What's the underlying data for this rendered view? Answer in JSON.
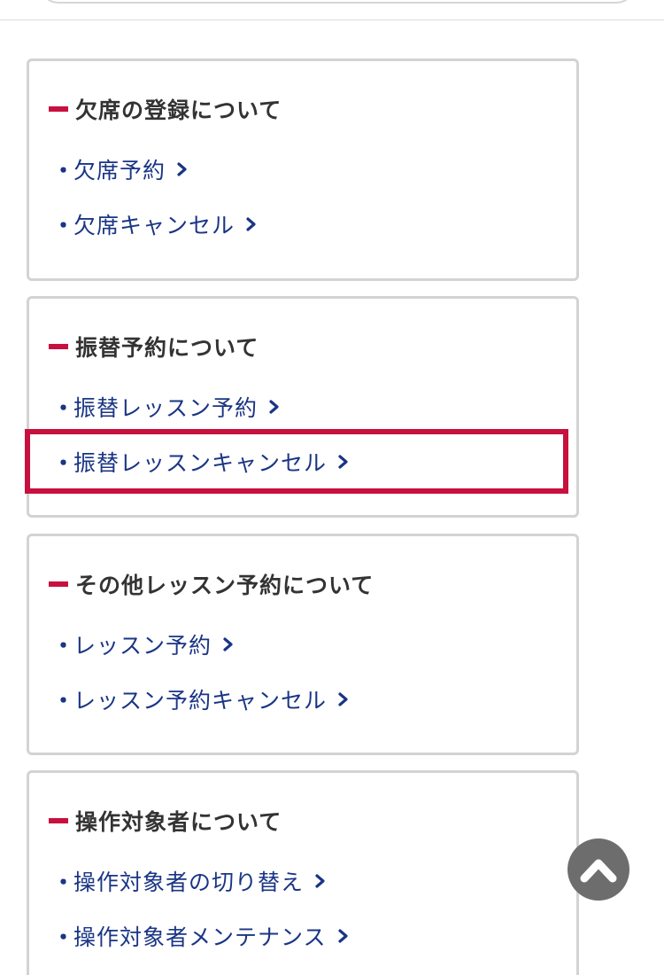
{
  "sections": [
    {
      "heading": "欠席の登録について",
      "links": [
        {
          "label": "欠席予約"
        },
        {
          "label": "欠席キャンセル"
        }
      ]
    },
    {
      "heading": "振替予約について",
      "links": [
        {
          "label": "振替レッスン予約"
        },
        {
          "label": "振替レッスンキャンセル"
        }
      ]
    },
    {
      "heading": "その他レッスン予約について",
      "links": [
        {
          "label": "レッスン予約"
        },
        {
          "label": "レッスン予約キャンセル"
        }
      ]
    },
    {
      "heading": "操作対象者について",
      "links": [
        {
          "label": "操作対象者の切り替え"
        },
        {
          "label": "操作対象者メンテナンス"
        }
      ]
    }
  ],
  "bullet": "・",
  "icons": {
    "link_arrow": "chevron-right-icon",
    "scroll_top": "chevron-up-icon"
  },
  "colors": {
    "accent": "#c8103f",
    "link": "#1a3585",
    "heading": "#333333",
    "card_border": "#d3d3d3",
    "scroll_button": "#6d6d6d"
  },
  "highlighted_link": "振替レッスンキャンセル"
}
